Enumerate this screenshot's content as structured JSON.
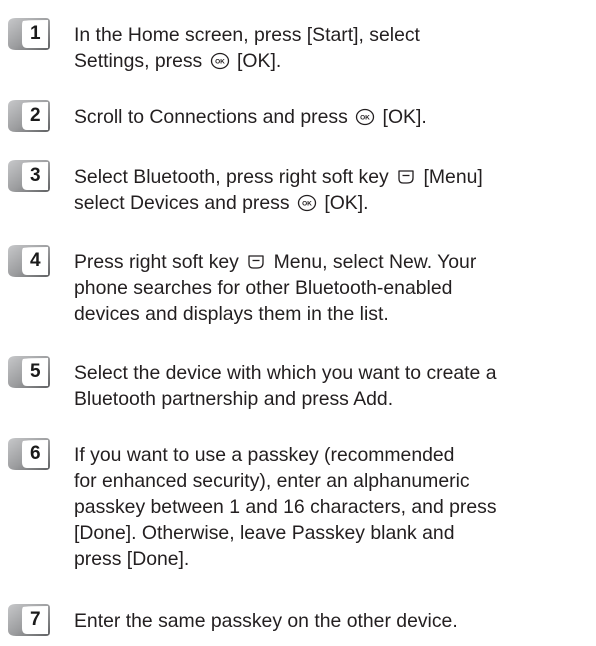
{
  "steps": [
    {
      "number": "1",
      "lines": [
        "In the Home screen, press [Start], select",
        "Settings, press {ok} [OK]."
      ]
    },
    {
      "number": "2",
      "lines": [
        "Scroll to Connections and press {ok} [OK]."
      ]
    },
    {
      "number": "3",
      "lines": [
        "Select Bluetooth, press right soft key {soft} [Menu]",
        "select Devices and press {ok} [OK]."
      ]
    },
    {
      "number": "4",
      "lines": [
        "Press right soft key {soft} Menu, select New. Your",
        "phone searches for other Bluetooth-enabled",
        "devices and displays them in the list."
      ]
    },
    {
      "number": "5",
      "lines": [
        "Select the device with which you want to create a",
        "Bluetooth partnership and press Add."
      ]
    },
    {
      "number": "6",
      "lines": [
        "If you want to use a passkey (recommended",
        "for enhanced security), enter an alphanumeric",
        "passkey between 1 and 16 characters, and press",
        "[Done]. Otherwise, leave Passkey blank and",
        "press [Done]."
      ]
    },
    {
      "number": "7",
      "lines": [
        "Enter the same passkey on the other device."
      ]
    }
  ],
  "icons": {
    "ok": "ok-key-icon",
    "soft": "right-soft-key-icon"
  },
  "colors": {
    "badge_fill": "#9a9b9d",
    "badge_shadow": "#5f6062",
    "text": "#231f20"
  }
}
